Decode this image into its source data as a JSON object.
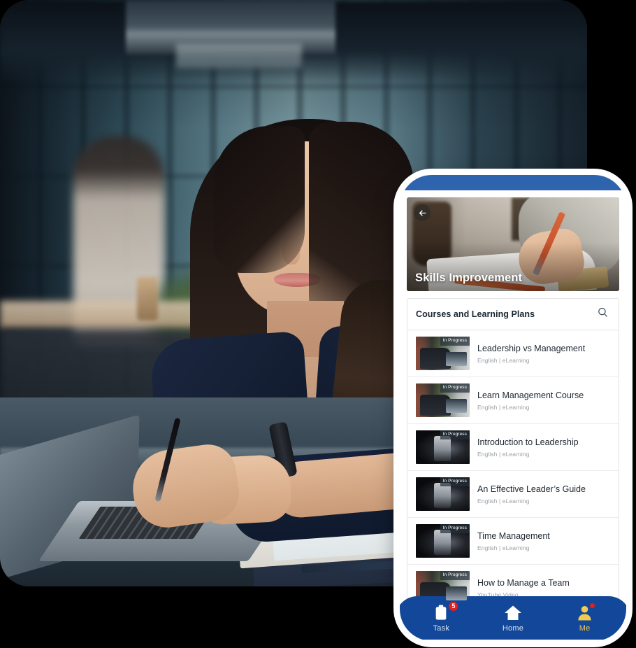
{
  "scene": {
    "background_color": "#000000",
    "photo": {
      "alt": "Businesswoman in navy blazer seated at an office desk with a laptop, documents and pen"
    }
  },
  "phone": {
    "status_strip_color": "#2E63AE",
    "banner": {
      "title": "Skills Improvement",
      "back_icon": "arrow-left-icon"
    },
    "card": {
      "header": "Courses and Learning Plans",
      "search_icon": "search-icon",
      "courses": [
        {
          "title": "Leadership vs Management",
          "meta": "English | eLearning",
          "badge": "In Progress",
          "thumb_style": "office"
        },
        {
          "title": "Learn Management Course",
          "meta": "English | eLearning",
          "badge": "In Progress",
          "thumb_style": "office"
        },
        {
          "title": "Introduction to Leadership",
          "meta": "English | eLearning",
          "badge": "In Progress",
          "thumb_style": "dark"
        },
        {
          "title": "An Effective Leader’s Guide",
          "meta": "English | eLearning",
          "badge": "In Progress",
          "thumb_style": "dark"
        },
        {
          "title": "Time Management",
          "meta": "English | eLearning",
          "badge": "In Progress",
          "thumb_style": "dark"
        },
        {
          "title": "How to Manage a Team",
          "meta": "YouTube Video",
          "badge": "In Progress",
          "thumb_style": "office"
        }
      ]
    },
    "bottom_nav": {
      "background_color": "#12479A",
      "active_color": "#F3C94F",
      "items": [
        {
          "label": "Task",
          "icon": "clipboard-icon",
          "badge": "5",
          "active": false
        },
        {
          "label": "Home",
          "icon": "home-icon",
          "badge": "",
          "active": false
        },
        {
          "label": "Me",
          "icon": "person-icon",
          "badge": "dot",
          "active": true
        }
      ]
    }
  }
}
